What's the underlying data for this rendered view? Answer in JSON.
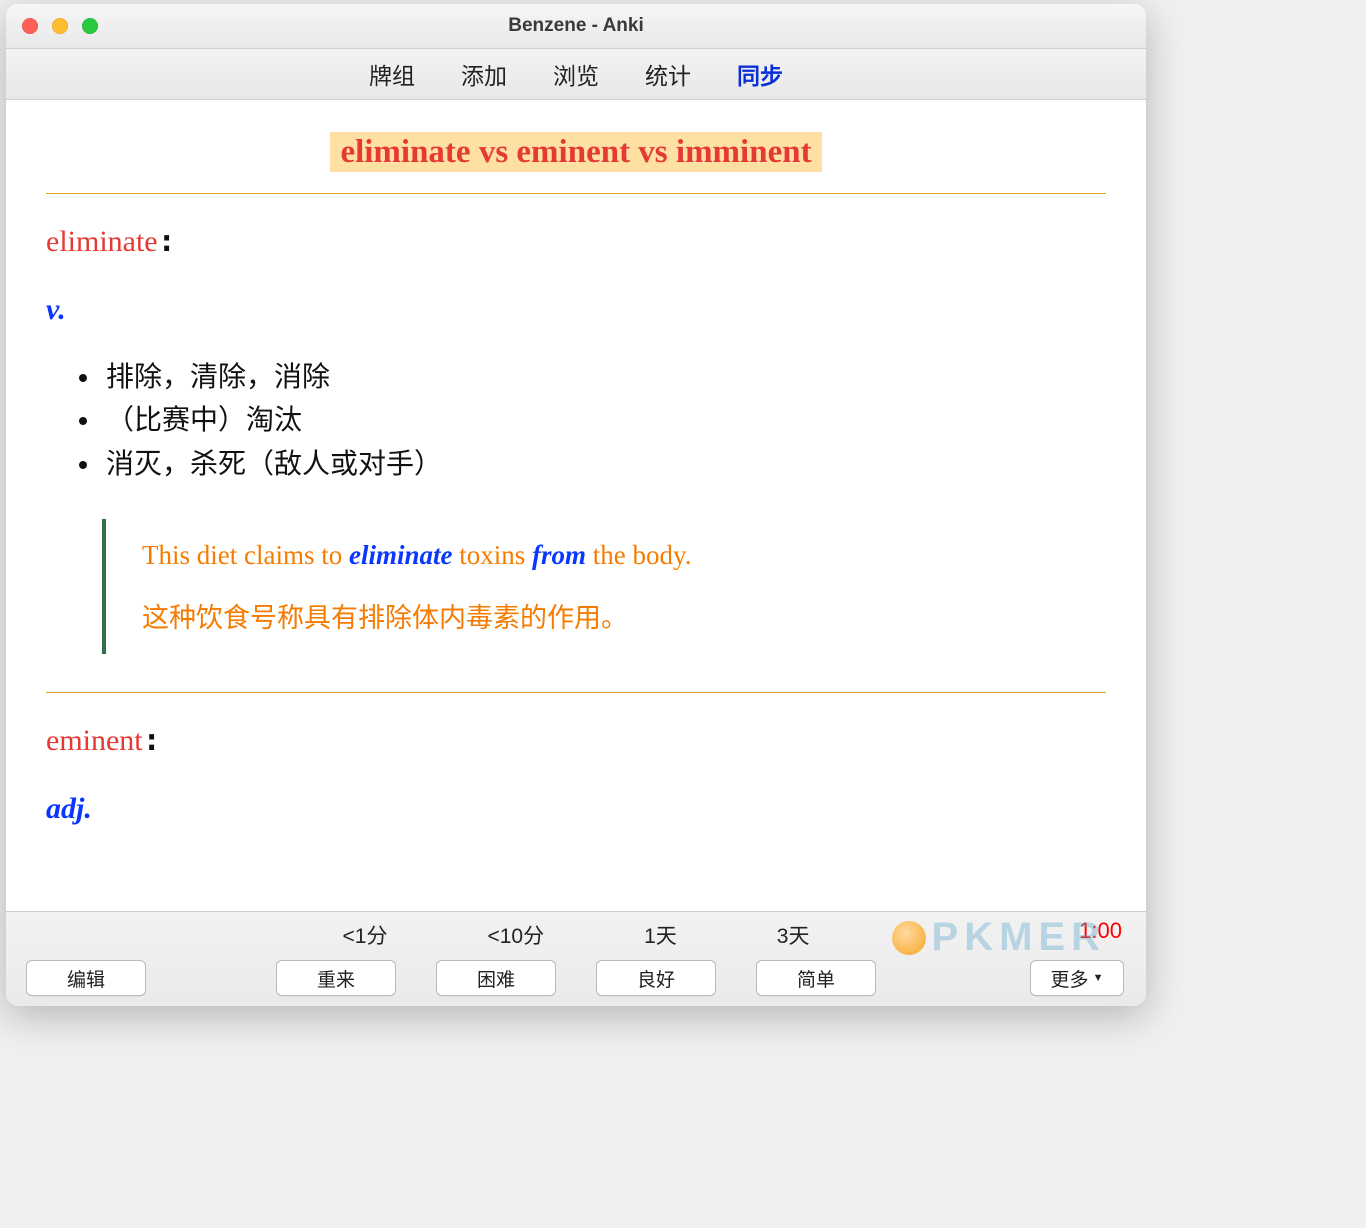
{
  "window": {
    "title": "Benzene - Anki"
  },
  "nav": {
    "items": [
      "牌组",
      "添加",
      "浏览",
      "统计",
      "同步"
    ],
    "activeIndex": 4
  },
  "card": {
    "title": "eliminate vs eminent vs imminent",
    "entries": [
      {
        "word": "eliminate",
        "pos": "v.",
        "defs": [
          "排除，清除，消除",
          "（比赛中）淘汰",
          "消灭，杀死（敌人或对手）"
        ],
        "example": {
          "pre": "This diet claims to ",
          "em1": "eliminate",
          "mid": " toxins ",
          "em2": "from",
          "post": " the body.",
          "zh": "这种饮食号称具有排除体内毒素的作用。"
        }
      },
      {
        "word": "eminent",
        "pos": "adj."
      }
    ]
  },
  "answer": {
    "intervals": [
      "<1分",
      "<10分",
      "1天",
      "3天"
    ],
    "buttons": [
      "重来",
      "困难",
      "良好",
      "简单"
    ],
    "edit": "编辑",
    "more": "更多",
    "timer": "1:00"
  },
  "watermark": "PKMER"
}
